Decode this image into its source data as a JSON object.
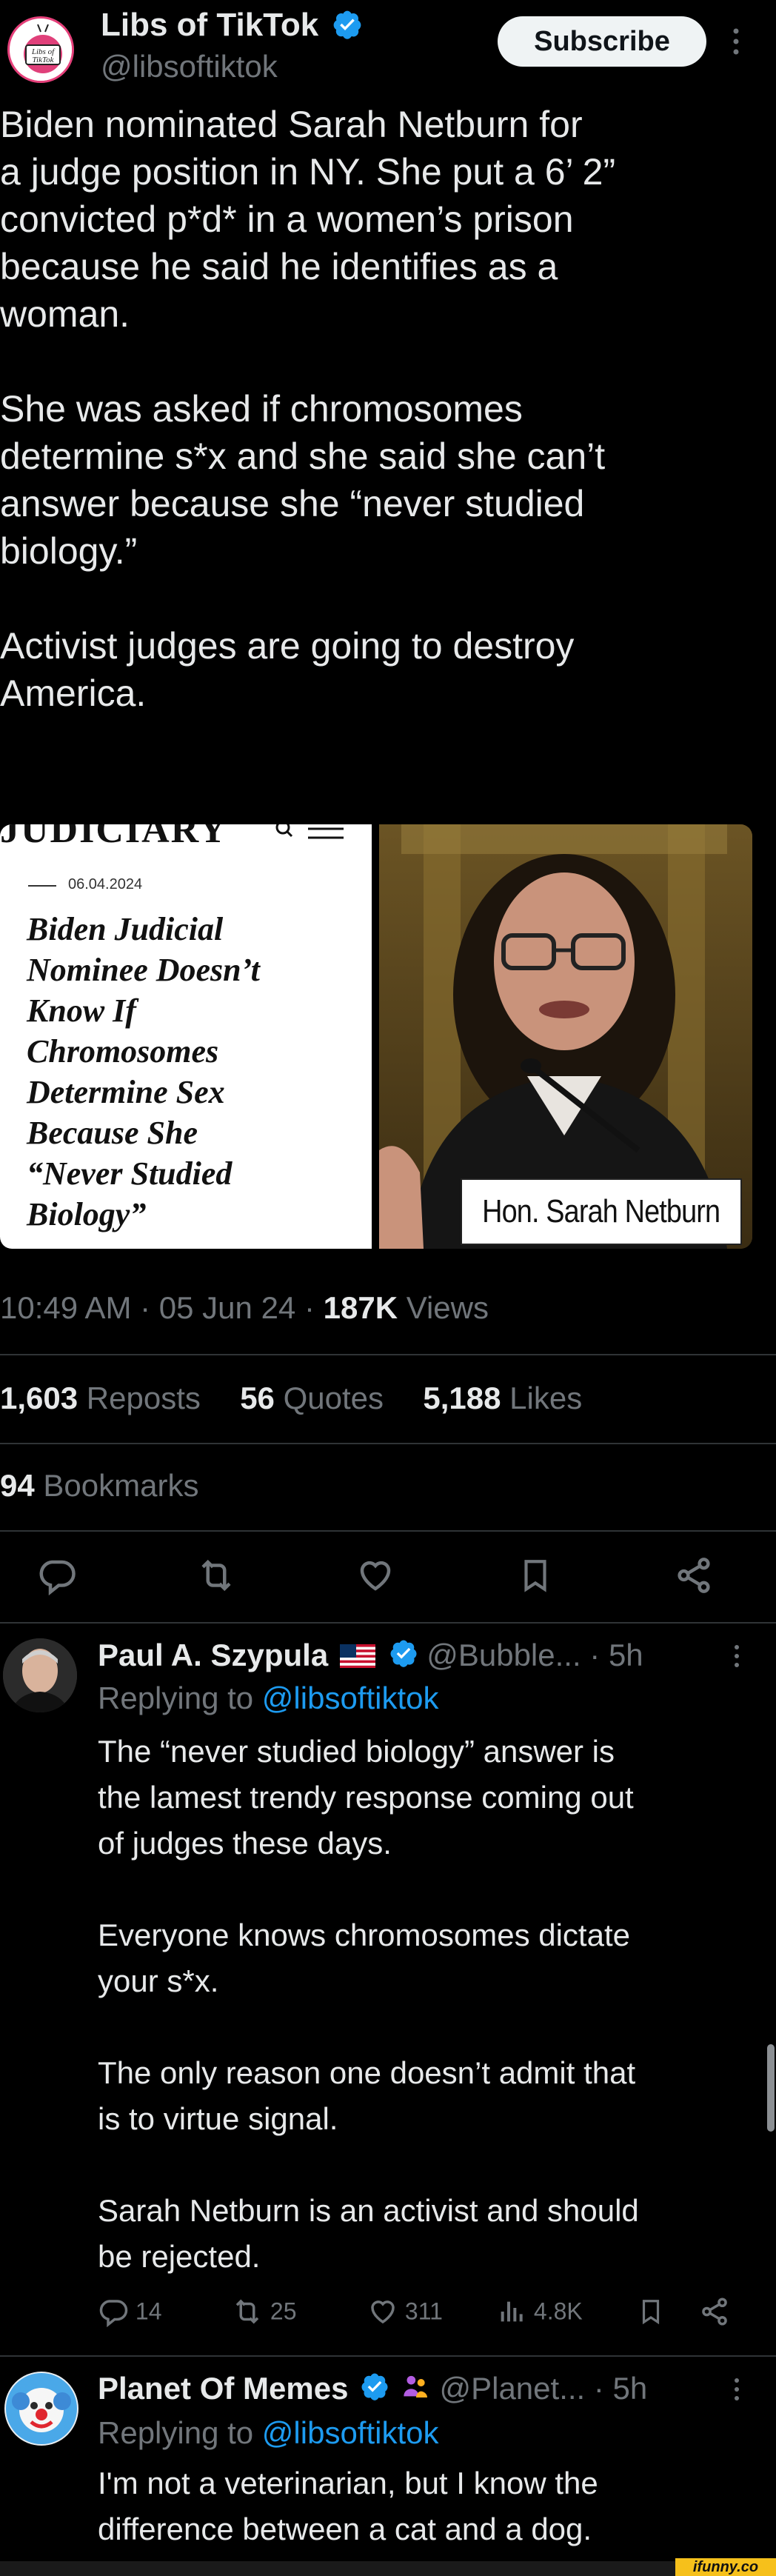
{
  "author": {
    "name": "Libs of TikTok",
    "handle": "@libsoftiktok",
    "avatar_text": "Libs of TikTok"
  },
  "subscribe_label": "Subscribe",
  "post": {
    "text": "Biden nominated Sarah Netburn for\na judge position in NY. She put a 6’ 2”\nconvicted p*d* in a women’s prison\nbecause he said he identifies as a\nwoman.\n\nShe was asked if chromosomes\ndetermine s*x and she said she can’t\nanswer because she “never studied\nbiology.”\n\nActivist judges are going to destroy\nAmerica.",
    "media_left": {
      "masthead": "JUDICIARY",
      "date": "06.04.2024",
      "headline": "Biden Judicial\nNominee Doesn’t\nKnow If\nChromosomes\nDetermine Sex\nBecause She\n“Never Studied\nBiology”"
    },
    "media_right": {
      "nameplate": "Hon. Sarah Netburn"
    },
    "time": "10:49 AM",
    "date": "05 Jun 24",
    "views_count": "187K",
    "views_label": "Views",
    "reposts_count": "1,603",
    "reposts_label": "Reposts",
    "quotes_count": "56",
    "quotes_label": "Quotes",
    "likes_count": "5,188",
    "likes_label": "Likes",
    "bookmarks_count": "94",
    "bookmarks_label": "Bookmarks"
  },
  "replies": [
    {
      "name": "Paul A. Szypula",
      "handle": "@Bubble...",
      "time": "5h",
      "replying_prefix": "Replying to",
      "replying_to": "@libsoftiktok",
      "text": "The “never studied biology” answer is\nthe lamest trendy response coming out\nof judges these days.\n\nEveryone knows chromosomes dictate\nyour s*x.\n\nThe only reason one doesn’t admit that\nis to virtue signal.\n\nSarah Netburn is an activist and should\nbe rejected.",
      "replies_count": "14",
      "reposts_count": "25",
      "likes_count": "311",
      "views_count": "4.8K"
    },
    {
      "name": "Planet Of Memes",
      "handle": "@Planet...",
      "time": "5h",
      "replying_prefix": "Replying to",
      "replying_to": "@libsoftiktok",
      "text": "I'm not a veterinarian, but I know the\ndifference between a cat and a dog."
    }
  ],
  "watermark": "ifunny.co",
  "colors": {
    "background": "#000000",
    "text": "#e7e9ea",
    "muted": "#71767b",
    "link": "#1d9bf0",
    "verified": "#1d9bf0",
    "divider": "#2f3336",
    "watermark_bar": "#f6c01b"
  }
}
